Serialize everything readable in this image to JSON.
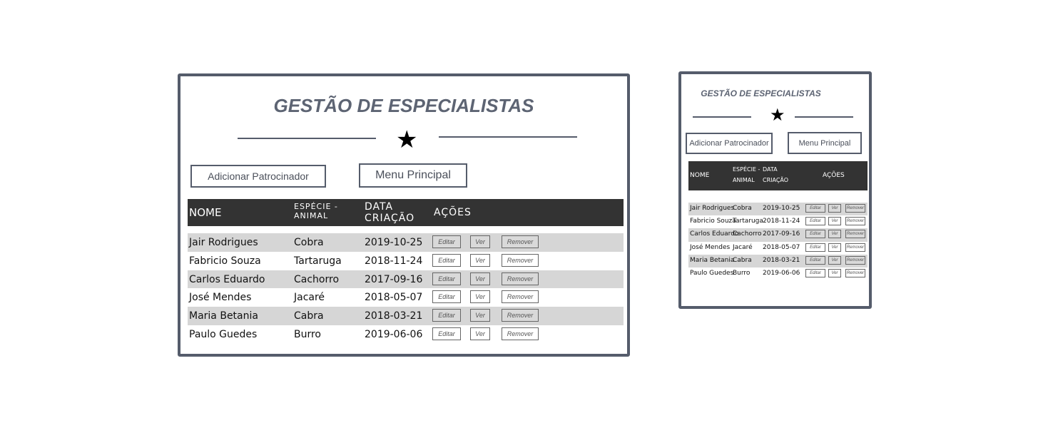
{
  "title": "GESTÃO DE ESPECIALISTAS",
  "buttons": {
    "add": "Adicionar Patrocinador",
    "menu": "Menu Principal"
  },
  "columns": {
    "nome": "NOME",
    "especie": "ESPÉCIE - ANIMAL",
    "data": "DATA CRIAÇÃO",
    "acoes": "AÇÕES"
  },
  "row_actions": {
    "edit": "Editar",
    "view": "Ver",
    "remove": "Remover"
  },
  "rows": [
    {
      "nome": "Jair Rodrigues",
      "especie": "Cobra",
      "data": "2019-10-25"
    },
    {
      "nome": "Fabricio Souza",
      "especie": "Tartaruga",
      "data": "2018-11-24"
    },
    {
      "nome": "Carlos Eduardo",
      "especie": "Cachorro",
      "data": "2017-09-16"
    },
    {
      "nome": "José Mendes",
      "especie": "Jacaré",
      "data": "2018-05-07"
    },
    {
      "nome": "Maria Betania",
      "especie": "Cabra",
      "data": "2018-03-21"
    },
    {
      "nome": "Paulo Guedes",
      "especie": "Burro",
      "data": "2019-06-06"
    }
  ],
  "colors": {
    "frame": "#555c6b",
    "header": "#333333",
    "shade": "#d6d6d6"
  },
  "icons": {
    "divider": "star-icon"
  }
}
